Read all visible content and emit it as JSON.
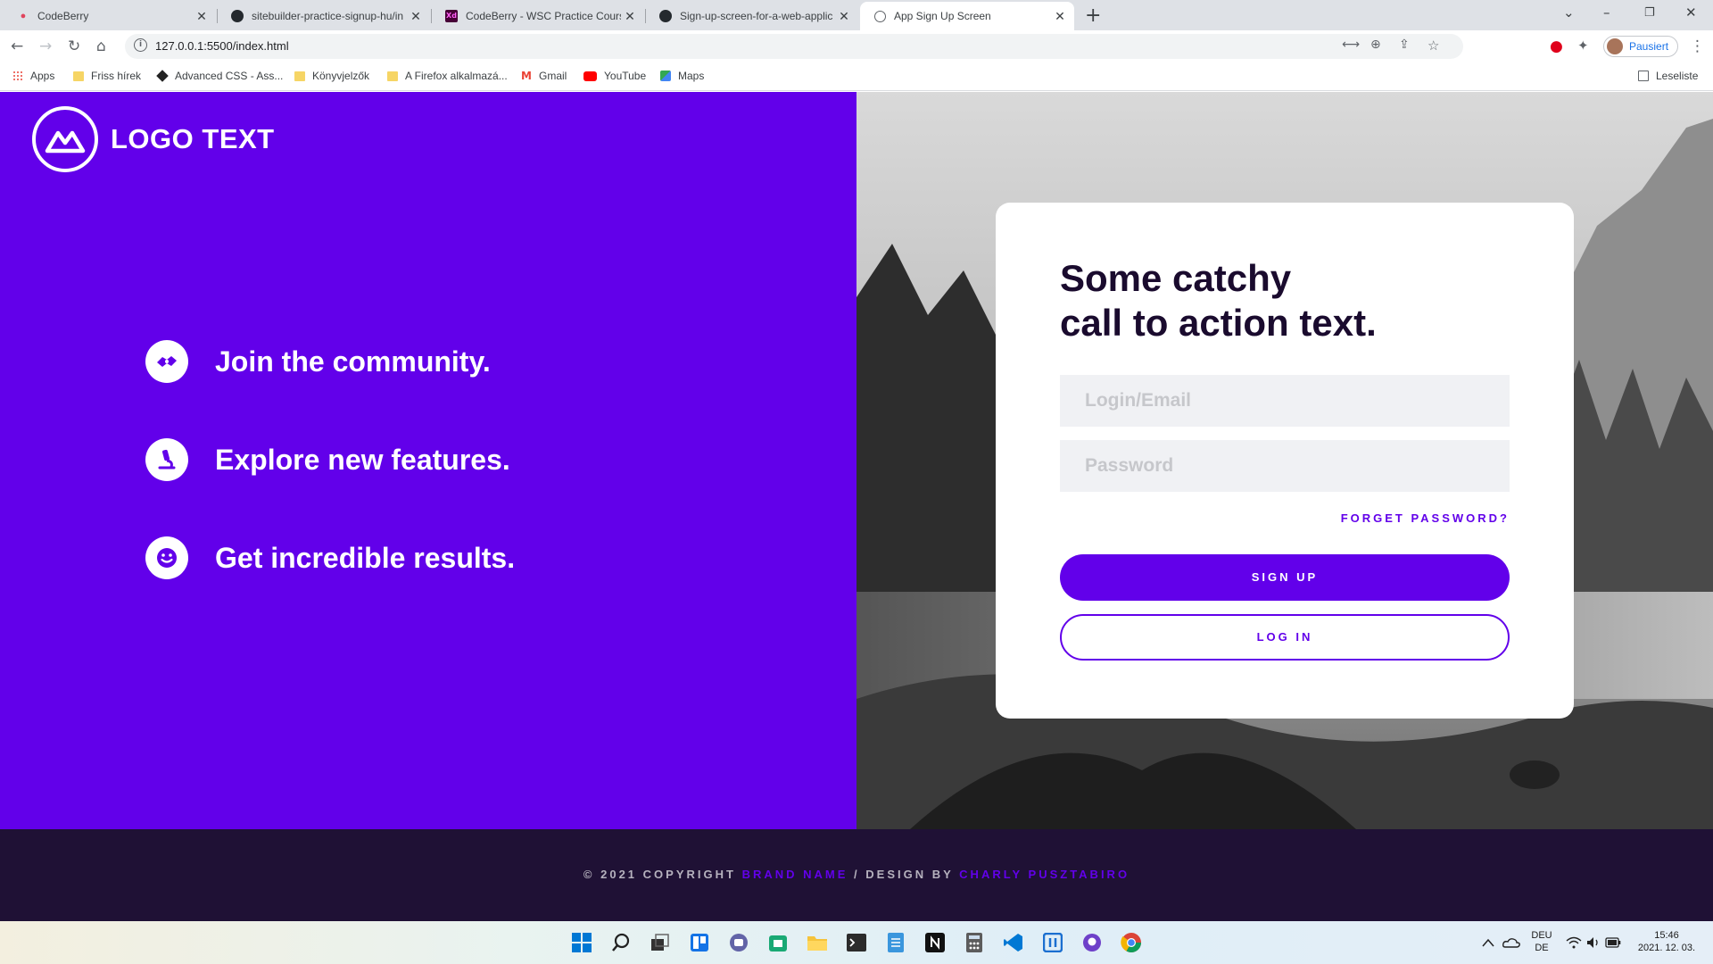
{
  "browser": {
    "tabs": [
      {
        "title": "CodeBerry",
        "icon": "codeberry-icon"
      },
      {
        "title": "sitebuilder-practice-signup-hu/in",
        "icon": "github-icon"
      },
      {
        "title": "CodeBerry - WSC Practice Course",
        "icon": "xd-icon"
      },
      {
        "title": "Sign-up-screen-for-a-web-applic",
        "icon": "github-icon"
      },
      {
        "title": "App Sign Up Screen",
        "icon": "globe-icon"
      }
    ],
    "url": "127.0.0.1:5500/index.html",
    "profile_label": "Pausiert",
    "bookmarks": [
      {
        "label": "Apps",
        "icon": "apps-grid-icon"
      },
      {
        "label": "Friss hírek",
        "icon": "folder-icon"
      },
      {
        "label": "Advanced CSS - Ass...",
        "icon": "diamond-icon"
      },
      {
        "label": "Könyvjelzők",
        "icon": "folder-icon"
      },
      {
        "label": "A Firefox alkalmazá...",
        "icon": "folder-icon"
      },
      {
        "label": "Gmail",
        "icon": "gmail-icon"
      },
      {
        "label": "YouTube",
        "icon": "youtube-icon"
      },
      {
        "label": "Maps",
        "icon": "maps-icon"
      }
    ],
    "reading_list": "Leseliste"
  },
  "page": {
    "logo_text": "LOGO TEXT",
    "features": [
      {
        "text": "Join the community.",
        "icon": "handshake-icon"
      },
      {
        "text": "Explore new features.",
        "icon": "microscope-icon"
      },
      {
        "text": "Get incredible results.",
        "icon": "smile-icon"
      }
    ],
    "card": {
      "headline_line1": "Some catchy",
      "headline_line2": "call to action text.",
      "login_placeholder": "Login/Email",
      "password_placeholder": "Password",
      "forget_password": "FORGET PASSWORD?",
      "signup_label": "SIGN UP",
      "login_label": "LOG IN"
    },
    "footer": {
      "prefix": "© 2021 COPYRIGHT",
      "brand": "BRAND NAME",
      "middle": "/ DESIGN BY",
      "designer": "CHARLY PUSZTABIRO"
    },
    "colors": {
      "primary": "#6200ea",
      "footer_bg": "#1f1135",
      "heading": "#1a0b2e"
    }
  },
  "taskbar": {
    "language_line1": "DEU",
    "language_line2": "DE",
    "time": "15:46",
    "date": "2021. 12. 03."
  }
}
